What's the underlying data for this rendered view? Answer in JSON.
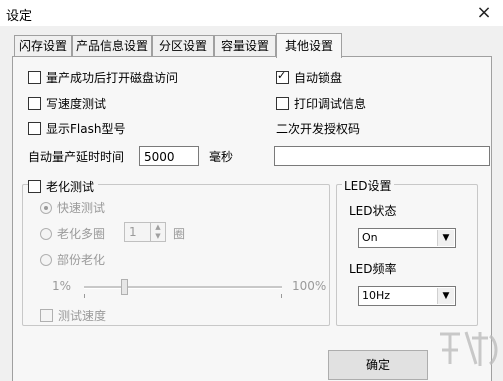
{
  "window": {
    "title": "设定",
    "close": "×"
  },
  "tabs": [
    "闪存设置",
    "产品信息设置",
    "分区设置",
    "容量设置",
    "其他设置"
  ],
  "left_options": [
    {
      "label": "量产成功后打开磁盘访问",
      "checked": false
    },
    {
      "label": "写速度测试",
      "checked": false
    },
    {
      "label": "显示Flash型号",
      "checked": false
    }
  ],
  "right_options": [
    {
      "label": "自动锁盘",
      "checked": true
    },
    {
      "label": "打印调试信息",
      "checked": false
    }
  ],
  "auth_code": {
    "label": "二次开发授权码",
    "value": ""
  },
  "auto_delay": {
    "label": "自动量产延时时间",
    "value": "5000",
    "unit": "毫秒"
  },
  "aging": {
    "title": "老化测试",
    "checked": false,
    "quick_test": "快速测试",
    "multi_cycle": "老化多圈",
    "cycle_value": "1",
    "cycle_unit": "圈",
    "partial": "部份老化",
    "slider_min": "1%",
    "slider_max": "100%",
    "slider_fraction": 0.2,
    "test_speed": "测试速度"
  },
  "led": {
    "title": "LED设置",
    "state_label": "LED状态",
    "state_value": "On",
    "freq_label": "LED频率",
    "freq_value": "10Hz"
  },
  "ok_button": "确定"
}
